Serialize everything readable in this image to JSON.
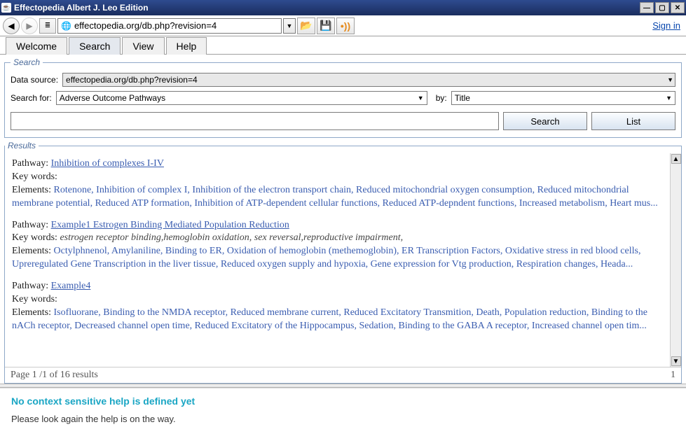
{
  "window": {
    "title": "Effectopedia  Albert J. Leo Edition"
  },
  "toolbar": {
    "url": "effectopedia.org/db.php?revision=4",
    "signin": "Sign in"
  },
  "tabs": [
    "Welcome",
    "Search",
    "View",
    "Help"
  ],
  "active_tab": 1,
  "search": {
    "legend": "Search",
    "data_source_label": "Data source:",
    "data_source_value": "effectopedia.org/db.php?revision=4",
    "search_for_label": "Search for:",
    "search_for_value": "Adverse Outcome Pathways",
    "by_label": "by:",
    "by_value": "Title",
    "search_btn": "Search",
    "list_btn": "List"
  },
  "results": {
    "legend": "Results",
    "items": [
      {
        "pathway_label": "Pathway: ",
        "pathway_link": "Inhibition of complexes I-IV",
        "keywords_label": "Key words:",
        "keywords": "",
        "elements_label": "Elements: ",
        "elements": "Rotenone, Inhibition of complex I, Inhibition of the electron transport chain, Reduced mitochondrial oxygen consumption, Reduced mitochondrial membrane potential, Reduced ATP formation, Inhibition of ATP-dependent cellular functions, Reduced ATP-depndent functions, Increased metabolism, Heart mus..."
      },
      {
        "pathway_label": "Pathway: ",
        "pathway_link": "Example1 Estrogen Binding Mediated Population Reduction",
        "keywords_label": "Key words: ",
        "keywords": "estrogen receptor binding,hemoglobin oxidation, sex reversal,reproductive impairment,",
        "elements_label": "Elements: ",
        "elements": "Octylphnenol, Amylaniline, Binding to ER, Oxidation of hemoglobin (methemoglobin), ER Transcription Factors, Oxidative stress in red blood cells, Upreregulated Gene Transcription in the liver tissue, Reduced oxygen supply and hypoxia, Gene expression for Vtg production, Respiration changes, Heada..."
      },
      {
        "pathway_label": "Pathway: ",
        "pathway_link": "Example4",
        "keywords_label": "Key words:",
        "keywords": "",
        "elements_label": "Elements: ",
        "elements": "Isofluorane, Binding to the NMDA receptor, Reduced membrane current, Reduced Excitatory Transmition, Death, Population reduction, Binding to the nACh receptor, Decreased channel open time, Reduced Excitatory of the Hippocampus, Sedation, Binding to the GABA A receptor, Increased channel open tim..."
      }
    ],
    "pager_left": "Page 1 /1 of 16 results",
    "pager_right": "1"
  },
  "help": {
    "title": "No context sensitive help is defined yet",
    "body": "Please look again the help is on the way."
  }
}
